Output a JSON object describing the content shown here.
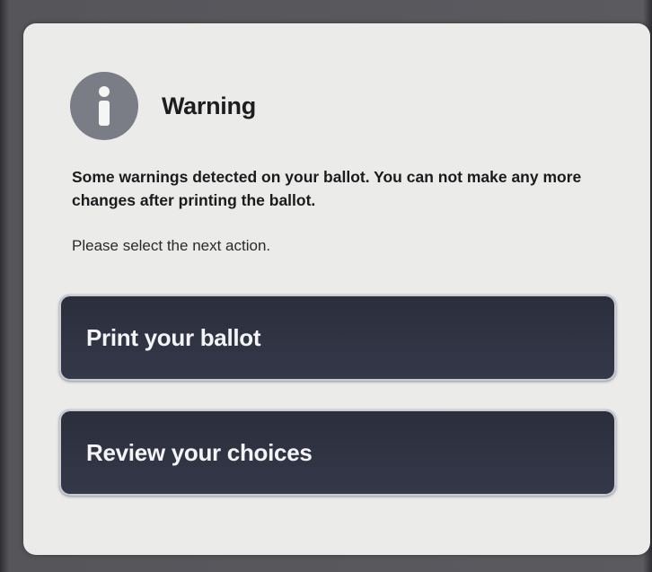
{
  "dialog": {
    "icon": "info-icon",
    "title": "Warning",
    "message": "Some warnings detected on your ballot. You can not make any more changes after printing the ballot.",
    "instruction": "Please select the next action."
  },
  "actions": {
    "print_label": "Print your ballot",
    "review_label": "Review your choices"
  },
  "colors": {
    "dialog_background": "#ebebea",
    "icon_background": "#7a7d86",
    "button_background": "#2b2e3b",
    "button_text": "#f4f4f6"
  }
}
